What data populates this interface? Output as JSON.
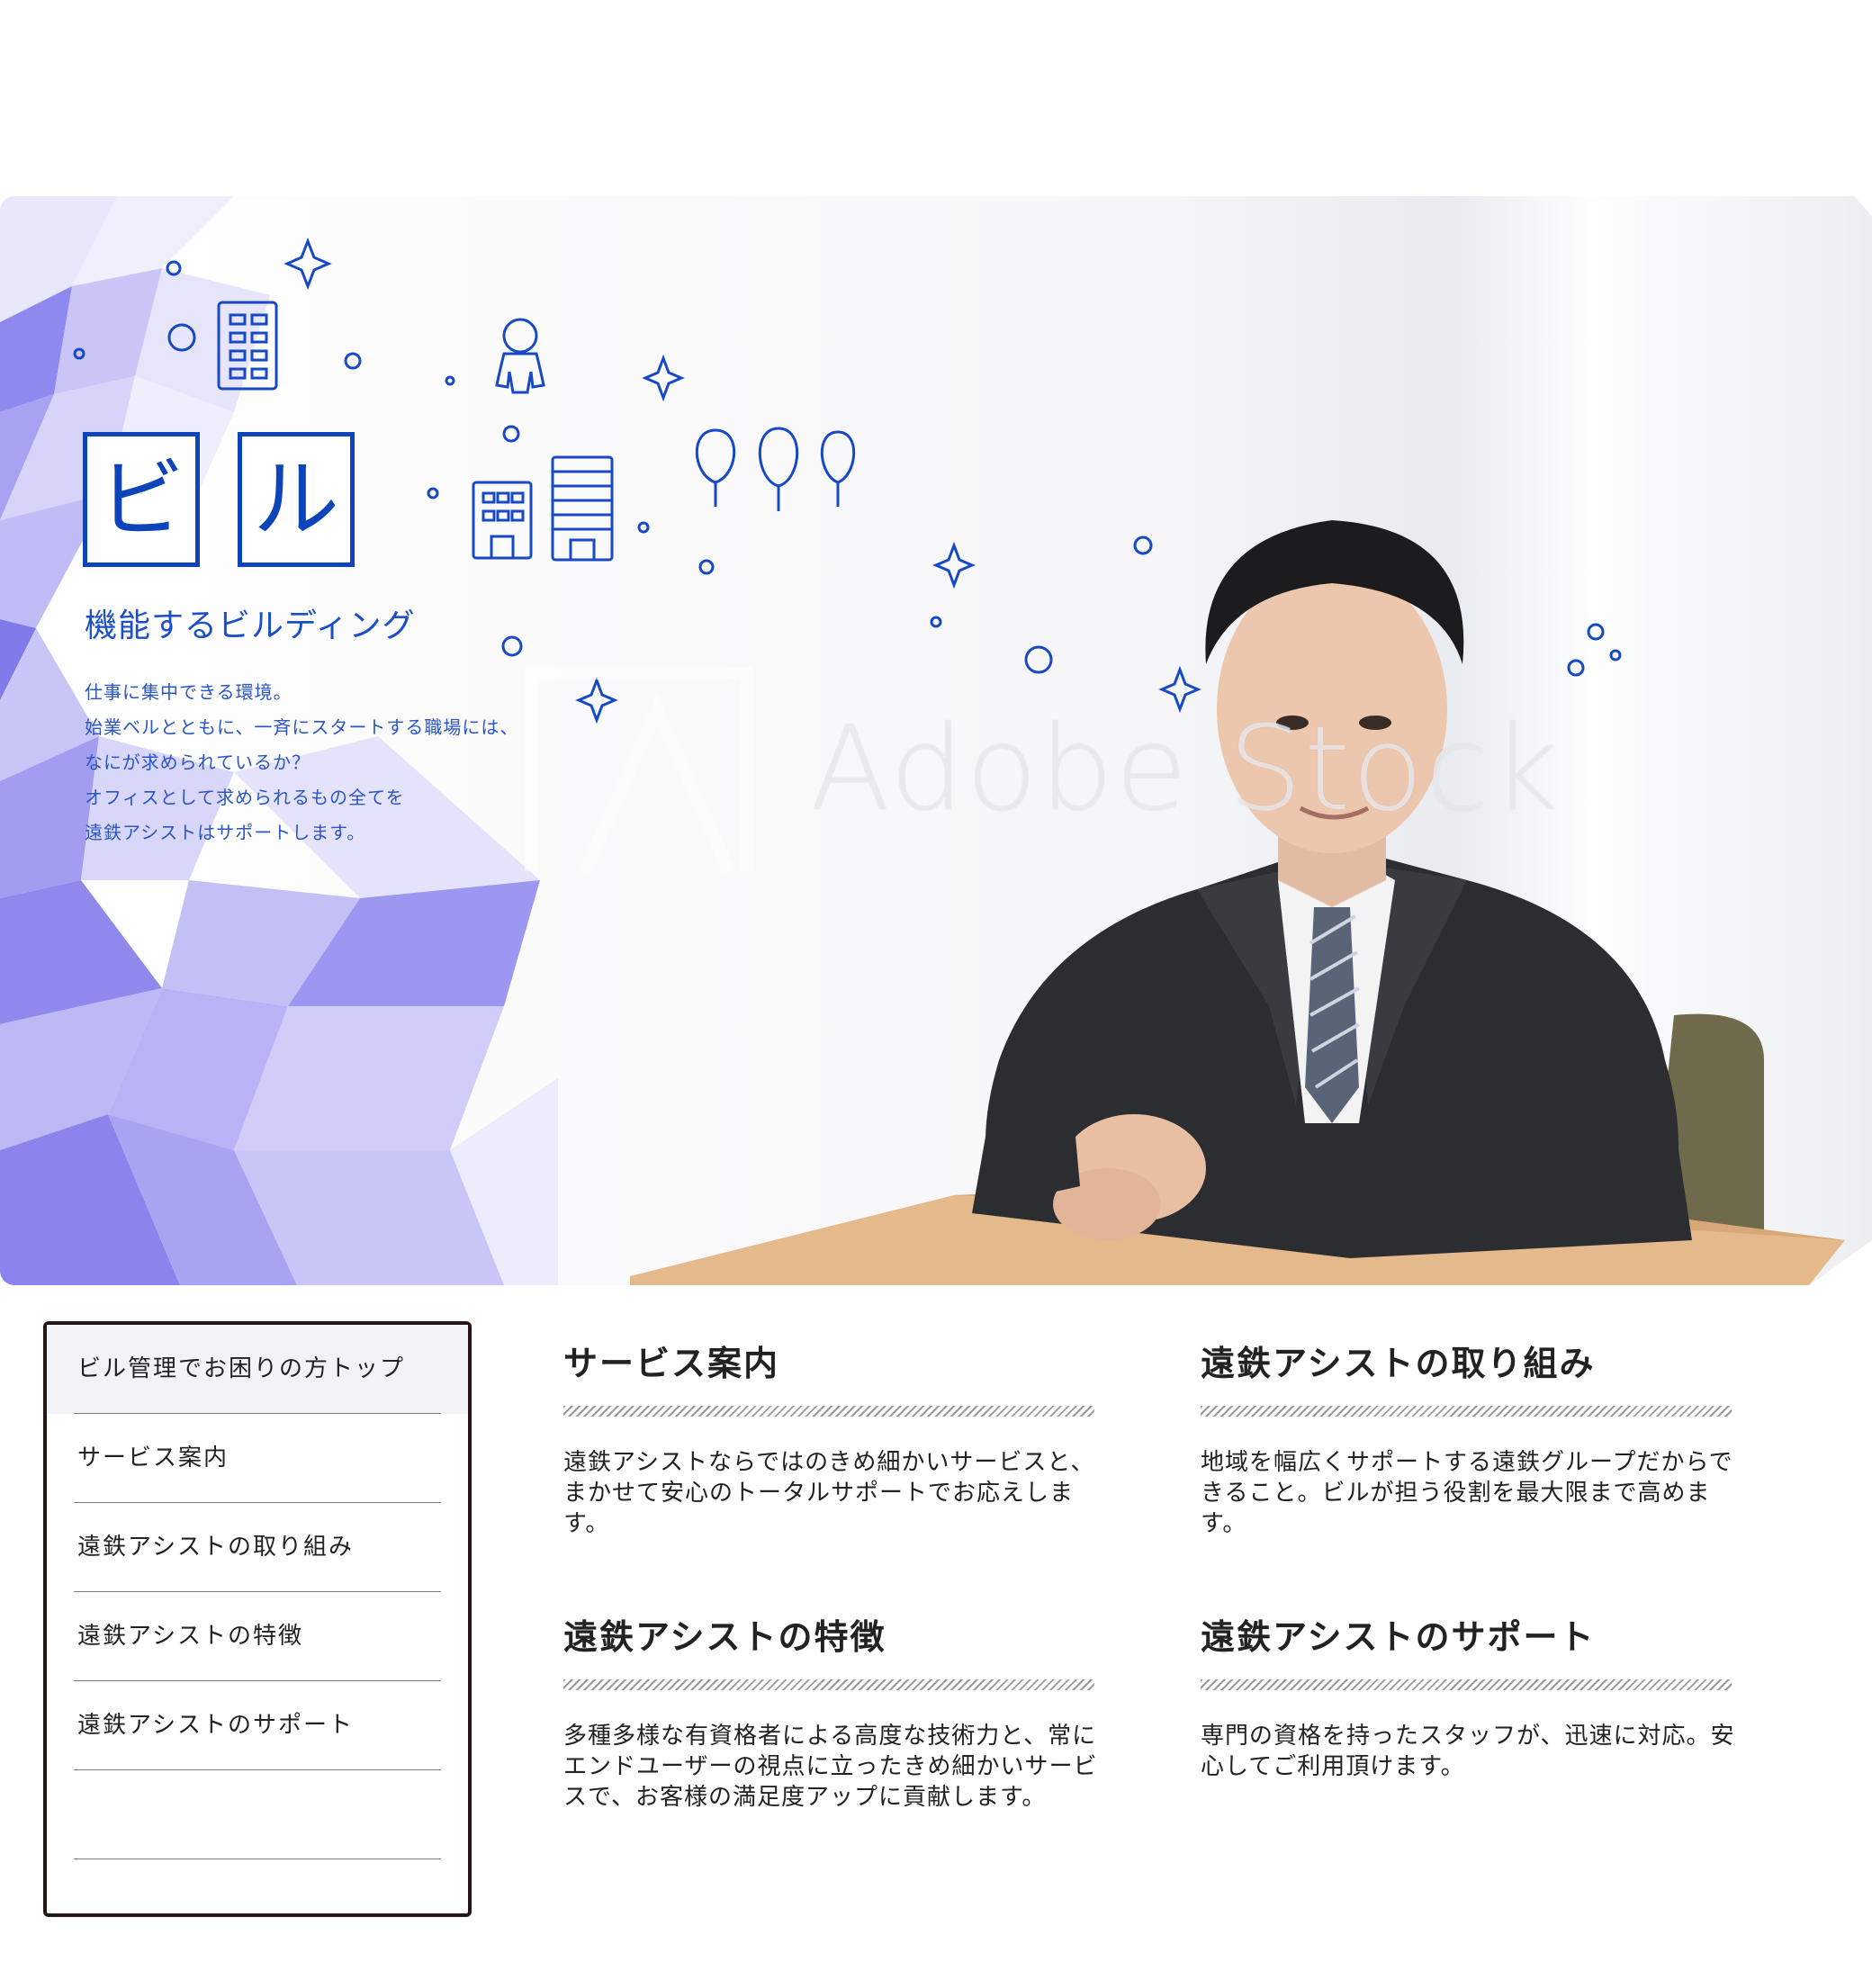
{
  "hero": {
    "logo_char_1": "ビ",
    "logo_char_2": "ル",
    "tagline": "機能するビルディング",
    "intro_lines": [
      "仕事に集中できる環境。",
      "始業ベルとともに、一斉にスタートする職場には、",
      "なにが求められているか？",
      "オフィスとして求められるもの全てを",
      "遠鉄アシストはサポートします。"
    ],
    "watermark": "Adobe Stock",
    "accent_color": "#0e44b9"
  },
  "side_menu": {
    "items": [
      {
        "label": "ビル管理でお困りの方トップ",
        "active": true
      },
      {
        "label": "サービス案内",
        "active": false
      },
      {
        "label": "遠鉄アシストの取り組み",
        "active": false
      },
      {
        "label": "遠鉄アシストの特徴",
        "active": false
      },
      {
        "label": "遠鉄アシストのサポート",
        "active": false
      },
      {
        "label": "",
        "active": false
      }
    ]
  },
  "sections": [
    {
      "title": "サービス案内",
      "body": "遠鉄アシストならではのきめ細かいサービスと、まかせて安心のトータルサポートでお応えします。"
    },
    {
      "title": "遠鉄アシストの取り組み",
      "body": "地域を幅広くサポートする遠鉄グループだからできること。ビルが担う役割を最大限まで高めます。"
    },
    {
      "title": "遠鉄アシストの特徴",
      "body": "多種多様な有資格者による高度な技術力と、常にエンドユーザーの視点に立ったきめ細かいサービスで、お客様の満足度アップに貢献します。"
    },
    {
      "title": "遠鉄アシストのサポート",
      "body": "専門の資格を持ったスタッフが、迅速に対応。安心してご利用頂けます。"
    }
  ]
}
